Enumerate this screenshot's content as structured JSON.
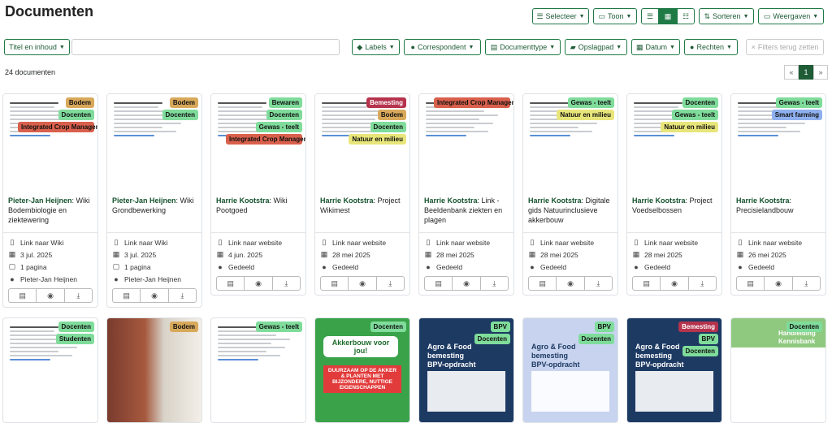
{
  "header": {
    "title": "Documenten"
  },
  "toolbar": {
    "select": "Selecteer",
    "show": "Toon",
    "sort": "Sorteren",
    "views": "Weergaven"
  },
  "filters": {
    "title_content": "Titel en inhoud",
    "labels": "Labels",
    "correspondent": "Correspondent",
    "doctype": "Documenttype",
    "storage": "Opslagpad",
    "date": "Datum",
    "rights": "Rechten",
    "reset": "Filters terug zetten"
  },
  "summary": {
    "count": "24 documenten"
  },
  "pager": {
    "prev": "«",
    "current": "1",
    "next": "»"
  },
  "colors": {
    "bodem": "#d9a95b",
    "docenten": "#7fdc9b",
    "icm": "#d9604c",
    "bewaren": "#7fdc9b",
    "bemesting": "#b5334d",
    "gewas": "#7fdc9b",
    "natuur": "#e8e67a",
    "smart": "#8fb0ef",
    "studenten": "#7fdc9b",
    "bpv": "#7fdc9b",
    "accent": "#1f7a46"
  },
  "cards": [
    {
      "author": "Pieter-Jan Heijnen",
      "title": ": Wiki Bodembiologie en ziektewering",
      "link": "Link naar Wiki",
      "date": "3 jul. 2025",
      "pages": "1 pagina",
      "owner": "Pieter-Jan Heijnen",
      "tags": [
        "Bodem",
        "Docenten",
        "Integrated Crop Management"
      ]
    },
    {
      "author": "Pieter-Jan Heijnen",
      "title": ": Wiki Grondbewerking",
      "link": "Link naar Wiki",
      "date": "3 jul. 2025",
      "pages": "1 pagina",
      "owner": "Pieter-Jan Heijnen",
      "tags": [
        "Bodem",
        "Docenten"
      ]
    },
    {
      "author": "Harrie Kootstra",
      "title": ": Wiki Pootgoed",
      "link": "Link naar website",
      "date": "4 jun. 2025",
      "owner": "Gedeeld",
      "tags": [
        "Bewaren",
        "Docenten",
        "Gewas - teelt",
        "Integrated Crop Management"
      ]
    },
    {
      "author": "Harrie Kootstra",
      "title": ": Project Wikimest",
      "link": "Link naar website",
      "date": "28 mei 2025",
      "owner": "Gedeeld",
      "tags": [
        "Bemesting",
        "Bodem",
        "Docenten",
        "Natuur en milieu"
      ]
    },
    {
      "author": "Harrie Kootstra",
      "title": ": Link - Beeldenbank ziekten en plagen",
      "link": "Link naar website",
      "date": "28 mei 2025",
      "owner": "Gedeeld",
      "tags": [
        "Integrated Crop Management"
      ]
    },
    {
      "author": "Harrie Kootstra",
      "title": ": Digitale gids Natuurinclusieve akkerbouw",
      "link": "Link naar website",
      "date": "28 mei 2025",
      "owner": "Gedeeld",
      "tags": [
        "Gewas - teelt",
        "Natuur en milieu"
      ]
    },
    {
      "author": "Harrie Kootstra",
      "title": ": Project Voedselbossen",
      "link": "Link naar website",
      "date": "28 mei 2025",
      "owner": "Gedeeld",
      "tags": [
        "Docenten",
        "Gewas - teelt",
        "Natuur en milieu"
      ]
    },
    {
      "author": "Harrie Kootstra",
      "title": ": Precisielandbouw",
      "link": "Link naar website",
      "date": "26 mei 2025",
      "owner": "Gedeeld",
      "tags": [
        "Gewas - teelt",
        "Smart farming"
      ]
    }
  ],
  "row2": [
    {
      "tags": [
        "Docenten",
        "Studenten"
      ]
    },
    {
      "tags": [
        "Bodem"
      ]
    },
    {
      "tags": [
        "Gewas - teelt"
      ]
    },
    {
      "tags": [
        "Docenten"
      ],
      "poster": "Akkerbouw voor jou!",
      "poster_sub": "DUURZAAM OP DE AKKER & PLANTEN MET BIJZONDERE, NUTTIGE EIGENSCHAPPEN"
    },
    {
      "tags": [
        "BPV",
        "Docenten"
      ],
      "heading": "Agro & Food bemesting BPV-opdracht"
    },
    {
      "tags": [
        "BPV",
        "Docenten"
      ],
      "heading": "Agro & Food bemesting BPV-opdracht"
    },
    {
      "tags": [
        "Bemesting",
        "BPV",
        "Docenten"
      ],
      "heading": "Agro & Food bemesting BPV-opdracht"
    },
    {
      "tags": [
        "Docenten"
      ],
      "heading": "Handleiding Kennisbank"
    }
  ]
}
